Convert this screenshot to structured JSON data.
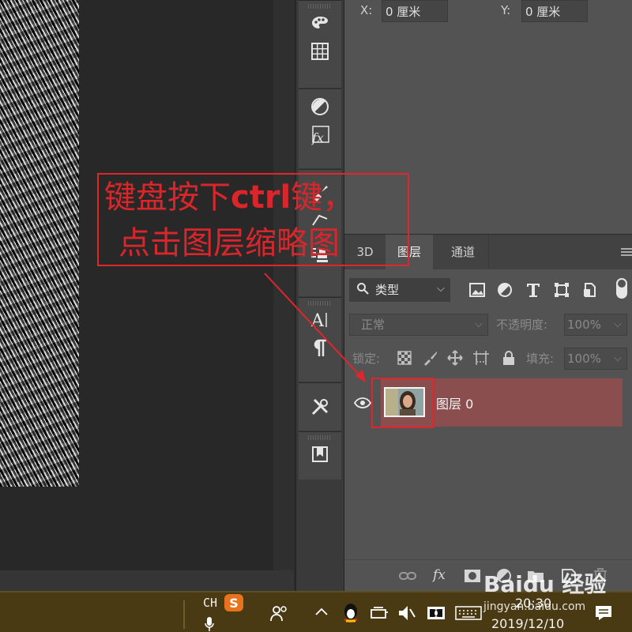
{
  "properties": {
    "x_label": "X:",
    "x_value": "0 厘米",
    "y_label": "Y:",
    "y_value": "0 厘米"
  },
  "layers_panel": {
    "tabs": [
      "3D",
      "图层",
      "通道"
    ],
    "active_tab": "图层",
    "filter_kind": "类型",
    "blend_mode": "正常",
    "opacity_label": "不透明度:",
    "opacity_value": "100%",
    "lock_label": "锁定:",
    "fill_label": "填充:",
    "fill_value": "100%",
    "layers": [
      {
        "name": "图层 0",
        "visible": true,
        "selected": true
      }
    ],
    "footer_icons": [
      "link-icon",
      "fx-icon",
      "mask-icon",
      "adjustment-icon",
      "group-icon",
      "new-layer-icon",
      "trash-icon"
    ]
  },
  "tools": [
    "palette-icon",
    "grid-icon",
    "adjust-icon",
    "fx-icon",
    "brush-icon",
    "paths-icon",
    "stamp-icon",
    "text-icon",
    "paragraph-icon",
    "tools-icon",
    "bookmark-icon"
  ],
  "annotation": {
    "line1_a": "键盘按下",
    "line1_b": "ctrl",
    "line1_c": "键，",
    "line2": "点击图层缩略图",
    "color": "#d9262b"
  },
  "taskbar": {
    "ime": "CH",
    "time": "20:30",
    "date": "2019/12/10"
  },
  "watermark": {
    "brand": "Baidu 经验",
    "url": "jingyan.baidu.com"
  }
}
